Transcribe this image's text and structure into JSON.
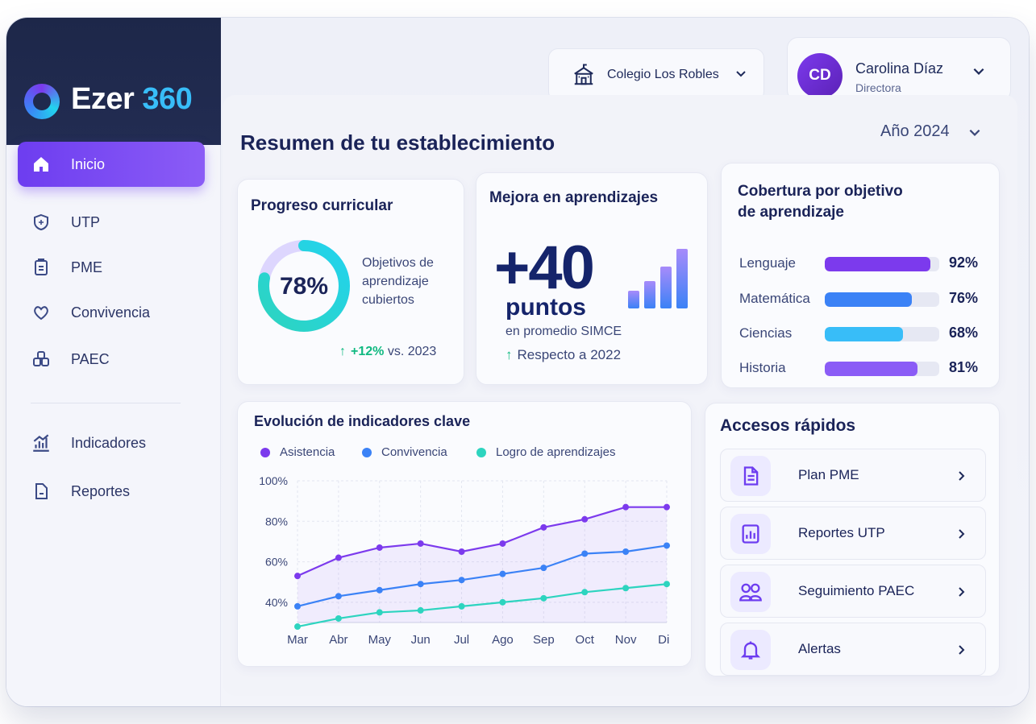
{
  "brand": {
    "name": "Ezer",
    "number": "360"
  },
  "sidebar": {
    "items": [
      {
        "label": "Inicio"
      },
      {
        "label": "UTP"
      },
      {
        "label": "PME"
      },
      {
        "label": "Convivencia"
      },
      {
        "label": "PAEC"
      },
      {
        "label": "Indicadores"
      },
      {
        "label": "Reportes"
      }
    ]
  },
  "header": {
    "school": "Colegio Los Robles",
    "user_initials": "CD",
    "user_name": "Carolina Díaz",
    "user_role": "Directora"
  },
  "page": {
    "title": "Resumen de tu establecimiento",
    "year": "Año 2024"
  },
  "progress": {
    "title": "Progreso curricular",
    "value_label": "78%",
    "percent": 78,
    "description": "Objetivos de aprendizaje cubiertos",
    "delta": "+12%",
    "delta_suffix": "vs. 2023"
  },
  "improvement": {
    "title": "Mejora en aprendizajes",
    "value": "+40",
    "unit": "puntos",
    "caption": "en promedio SIMCE",
    "note": "Respecto a 2022"
  },
  "coverage": {
    "title_line1": "Cobertura por objetivo",
    "title_line2": "de aprendizaje",
    "rows": [
      {
        "name": "Lenguaje",
        "value": "92%",
        "pct": 92,
        "color": "#7c3aed"
      },
      {
        "name": "Matemática",
        "value": "76%",
        "pct": 76,
        "color": "#3b82f6"
      },
      {
        "name": "Ciencias",
        "value": "68%",
        "pct": 68,
        "color": "#38bdf8"
      },
      {
        "name": "Historia",
        "value": "81%",
        "pct": 81,
        "color": "#8b5cf6"
      }
    ]
  },
  "trend": {
    "title": "Evolución de indicadores clave"
  },
  "chart_data": {
    "type": "line",
    "x": [
      "Mar",
      "Abr",
      "May",
      "Jun",
      "Jul",
      "Ago",
      "Sep",
      "Oct",
      "Nov",
      "Dic"
    ],
    "ylim": [
      30,
      100
    ],
    "yticks": [
      "100%",
      "80%",
      "60%",
      "40%"
    ],
    "ytick_values": [
      100,
      80,
      60,
      40
    ],
    "grid": true,
    "series": [
      {
        "name": "Asistencia",
        "color": "#7c3aed",
        "values": [
          53,
          62,
          67,
          69,
          65,
          69,
          77,
          81,
          87,
          87
        ]
      },
      {
        "name": "Convivencia",
        "color": "#3b82f6",
        "values": [
          38,
          43,
          46,
          49,
          51,
          54,
          57,
          64,
          65,
          68
        ]
      },
      {
        "name": "Logro de aprendizajes",
        "color": "#2dd4bf",
        "values": [
          28,
          32,
          35,
          36,
          38,
          40,
          42,
          45,
          47,
          49
        ]
      }
    ]
  },
  "quick": {
    "title": "Accesos rápidos",
    "items": [
      {
        "label": "Plan PME"
      },
      {
        "label": "Reportes UTP"
      },
      {
        "label": "Seguimiento PAEC"
      },
      {
        "label": "Alertas"
      }
    ]
  }
}
